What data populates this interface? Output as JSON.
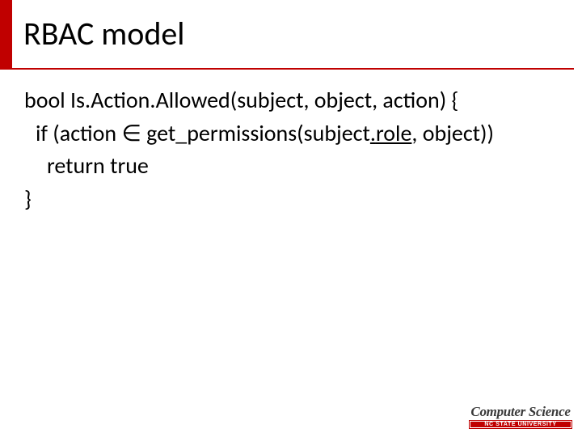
{
  "title": "RBAC model",
  "code": {
    "line1_prefix": "bool Is",
    "line1_mid": "Action",
    "line1_suffix": "Allowed(subject, object, action) {",
    "line2_prefix": " if (action ∈ get_permissions(subject",
    "line2_dot": ".",
    "line2_role": "role",
    "line2_suffix": ", object))",
    "line3": "  return true",
    "line4": "}"
  },
  "logo": {
    "dept": "Computer Science",
    "univ": "NC STATE UNIVERSITY"
  }
}
